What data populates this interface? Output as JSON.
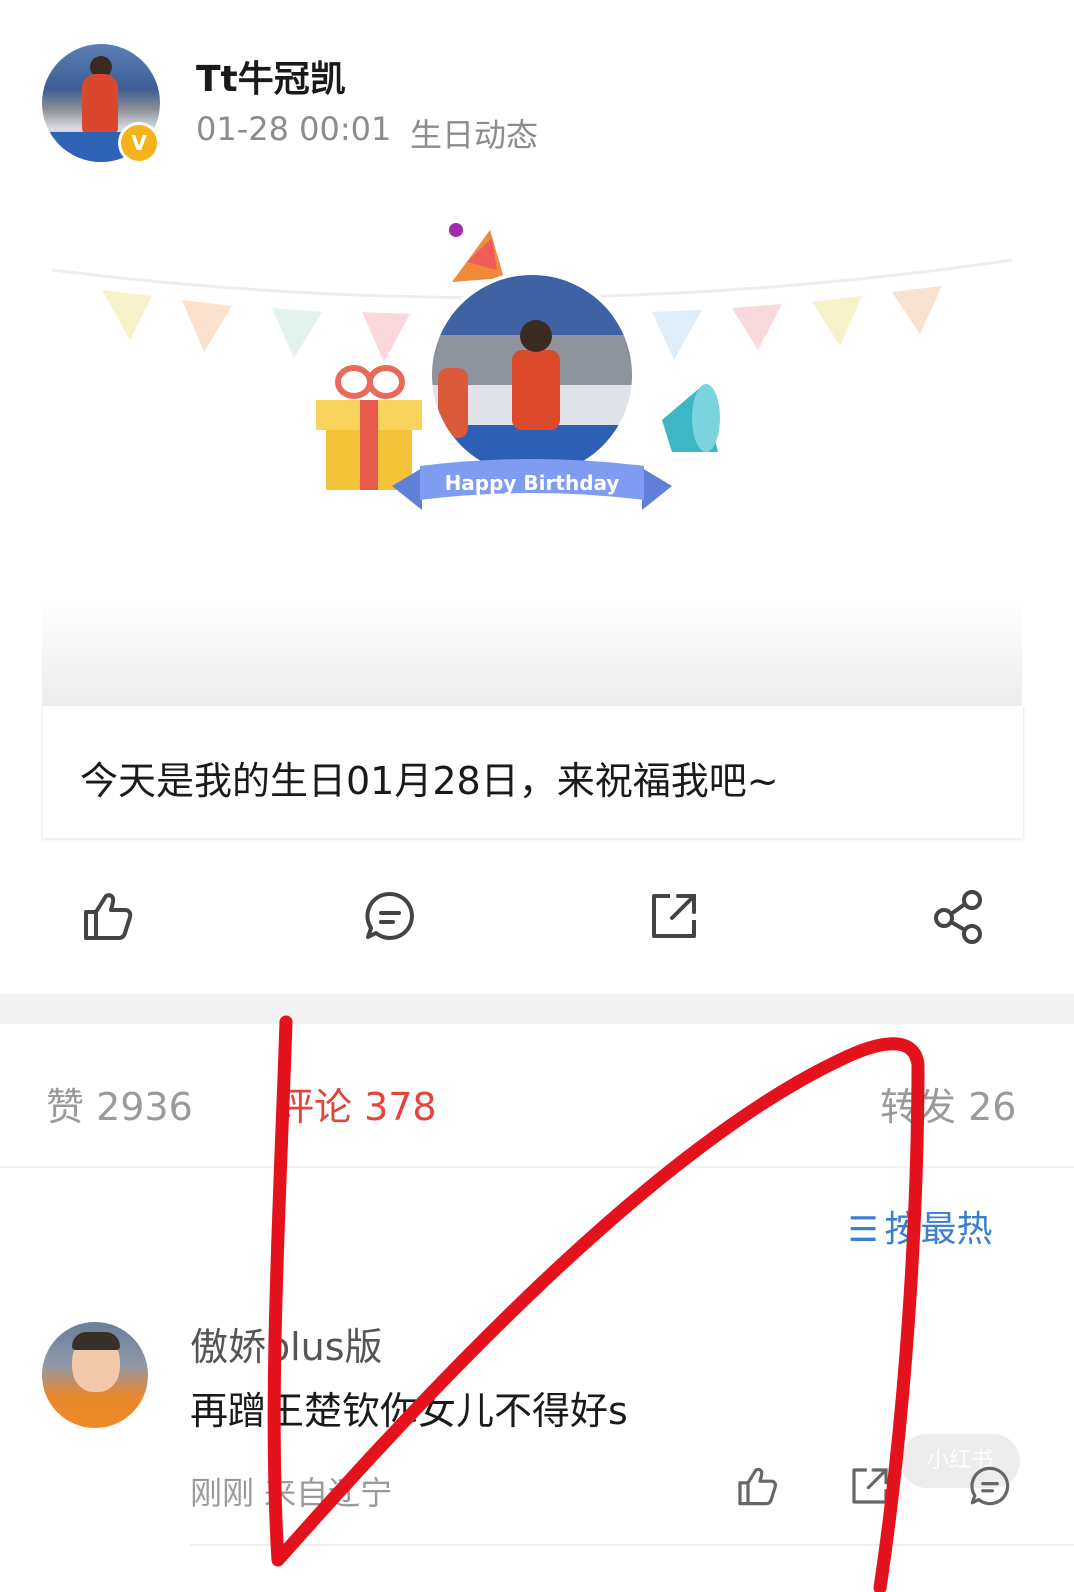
{
  "post": {
    "username": "Tt牛冠凯",
    "verified_badge": "V",
    "time": "01-28 00:01",
    "tag": "生日动态",
    "card": {
      "banner_text": "Happy Birthday",
      "caption": "今天是我的生日01月28日，来祝福我吧~"
    }
  },
  "actions": [
    {
      "name": "like",
      "icon": "thumbs-up-icon"
    },
    {
      "name": "comment",
      "icon": "comment-bubble-icon"
    },
    {
      "name": "repost",
      "icon": "share-box-icon"
    },
    {
      "name": "share",
      "icon": "share-nodes-icon"
    }
  ],
  "stats": {
    "likes": "赞 2936",
    "comments": "评论 378",
    "reposts": "转发 26"
  },
  "sort": {
    "label": "按最热",
    "icon": "sort-lines-icon"
  },
  "comment": {
    "user": "傲娇plus版",
    "text": "再蹭王楚钦你女儿不得好s",
    "meta": "刚刚 来自辽宁"
  },
  "watermark": "小红书",
  "colors": {
    "accent_red": "#e0463e",
    "link_blue": "#3c7fd0",
    "badge_gold": "#f6b21a",
    "annotation_red": "#e3121c"
  }
}
